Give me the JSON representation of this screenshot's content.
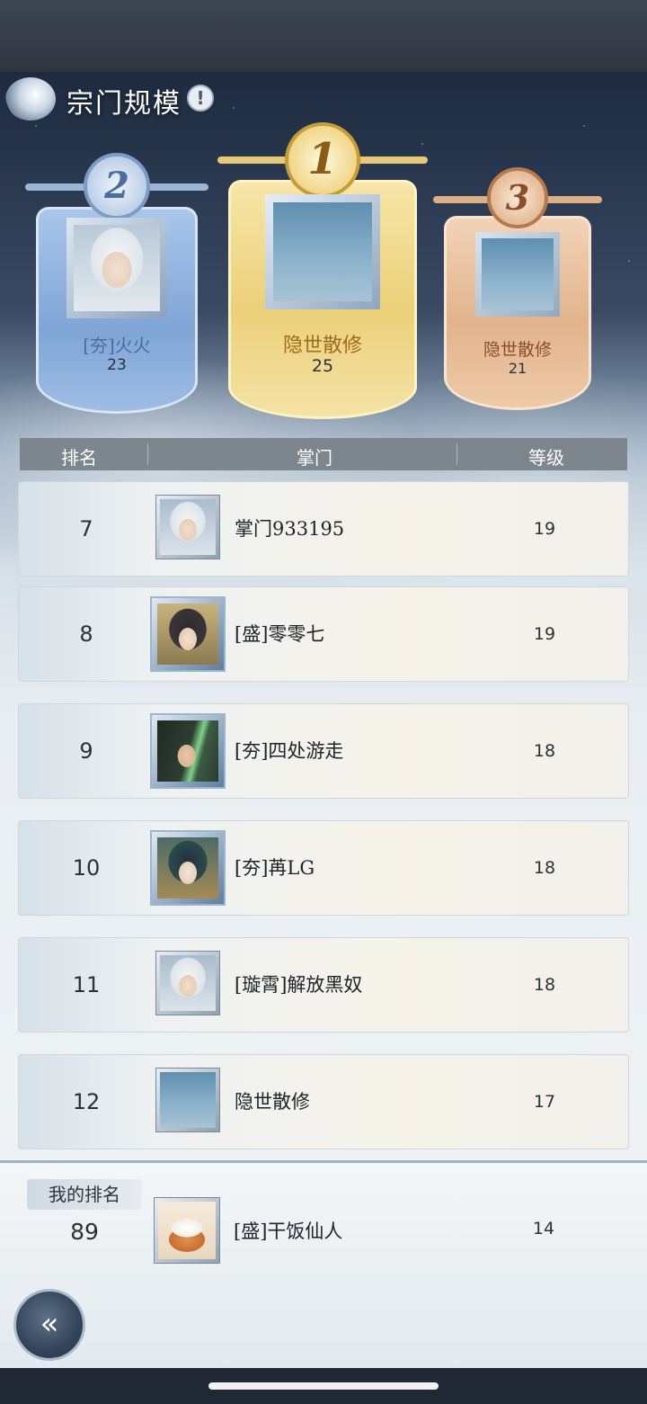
{
  "header": {
    "title": "宗门规模",
    "info_glyph": "!"
  },
  "podium": [
    {
      "place": "1",
      "name": "隐世散修",
      "level": "25"
    },
    {
      "place": "2",
      "name": "[夯]火火",
      "level": "23"
    },
    {
      "place": "3",
      "name": "隐世散修",
      "level": "21"
    }
  ],
  "table": {
    "columns": [
      "排名",
      "掌门",
      "等级"
    ],
    "rows": [
      {
        "rank": "7",
        "name": "掌门933195",
        "level": "19"
      },
      {
        "rank": "8",
        "name": "[盛]零零七",
        "level": "19"
      },
      {
        "rank": "9",
        "name": "[夯]四处游走",
        "level": "18"
      },
      {
        "rank": "10",
        "name": "[夯]苒LG",
        "level": "18"
      },
      {
        "rank": "11",
        "name": "[璇霄]解放黑奴",
        "level": "18"
      },
      {
        "rank": "12",
        "name": "隐世散修",
        "level": "17"
      }
    ]
  },
  "my_rank": {
    "label": "我的排名",
    "rank": "89",
    "name": "[盛]干饭仙人",
    "level": "14"
  },
  "back_glyph": "«",
  "colors": {
    "gold": "#ecd07a",
    "silver": "#7fa5d6",
    "bronze": "#e2b38d",
    "header_bar": "#7d858d"
  }
}
